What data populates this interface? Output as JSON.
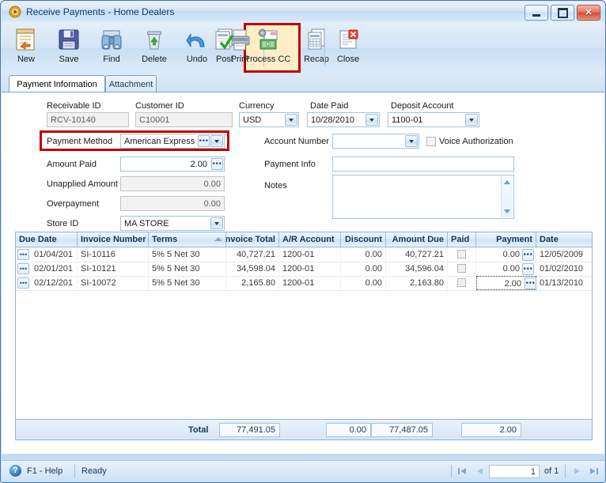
{
  "window": {
    "title": "Receive Payments - Home Dealers",
    "app_icon": "play-circle-icon",
    "controls": {
      "minimize": "Minimize",
      "maximize": "Maximize",
      "close": "Close"
    }
  },
  "toolbar": {
    "items": [
      {
        "label": "New",
        "icon": "new-document-icon"
      },
      {
        "label": "Save",
        "icon": "save-floppy-icon"
      },
      {
        "label": "Find",
        "icon": "binoculars-icon"
      },
      {
        "label": "Delete",
        "icon": "recycle-bin-icon"
      },
      {
        "label": "Undo",
        "icon": "undo-arrow-icon"
      },
      {
        "label": "Print",
        "icon": "printer-icon"
      },
      {
        "label": "Post",
        "icon": "post-checkmark-icon"
      },
      {
        "label": "Process CC",
        "icon": "process-credit-card-icon"
      },
      {
        "label": "Recap",
        "icon": "recap-documents-icon"
      },
      {
        "label": "Close",
        "icon": "close-document-icon"
      }
    ]
  },
  "tabs": [
    {
      "label": "Payment Information",
      "active": true
    },
    {
      "label": "Attachment",
      "active": false
    }
  ],
  "form": {
    "receivable_id": {
      "label": "Receivable ID",
      "value": "RCV-10140"
    },
    "customer_id": {
      "label": "Customer ID",
      "value": "C10001"
    },
    "currency": {
      "label": "Currency",
      "value": "USD"
    },
    "date_paid": {
      "label": "Date Paid",
      "value": "10/28/2010"
    },
    "deposit_account": {
      "label": "Deposit Account",
      "value": "1100-01"
    },
    "payment_method": {
      "label": "Payment Method",
      "value": "American Express"
    },
    "amount_paid": {
      "label": "Amount Paid",
      "value": "2.00"
    },
    "unapplied_amount": {
      "label": "Unapplied Amount",
      "value": "0.00"
    },
    "overpayment": {
      "label": "Overpayment",
      "value": "0.00"
    },
    "store_id": {
      "label": "Store ID",
      "value": "MA STORE"
    },
    "account_number": {
      "label": "Account Number",
      "value": ""
    },
    "voice_auth": {
      "label": "Voice Authorization",
      "checked": false
    },
    "payment_info": {
      "label": "Payment Info",
      "value": ""
    },
    "notes": {
      "label": "Notes",
      "value": ""
    }
  },
  "grid": {
    "columns": [
      {
        "key": "due_date",
        "label": "Due Date",
        "align": "left"
      },
      {
        "key": "invoice_number",
        "label": "Invoice Number",
        "align": "left"
      },
      {
        "key": "terms",
        "label": "Terms",
        "align": "left",
        "sorted": true
      },
      {
        "key": "invoice_total",
        "label": "nvoice Total",
        "align": "right"
      },
      {
        "key": "ar_account",
        "label": "A/R Account",
        "align": "left"
      },
      {
        "key": "discount",
        "label": "Discount",
        "align": "right"
      },
      {
        "key": "amount_due",
        "label": "Amount Due",
        "align": "right"
      },
      {
        "key": "paid",
        "label": "Paid",
        "align": "left"
      },
      {
        "key": "payment",
        "label": "Payment",
        "align": "right"
      },
      {
        "key": "date",
        "label": "Date",
        "align": "left"
      }
    ],
    "rows": [
      {
        "due_date": "01/04/201",
        "invoice_number": "SI-10116",
        "terms": "5% 5 Net 30",
        "invoice_total": "40,727.21",
        "ar_account": "1200-01",
        "discount": "0.00",
        "amount_due": "40,727.21",
        "paid": false,
        "payment": "0.00",
        "date": "12/05/2009"
      },
      {
        "due_date": "02/01/201",
        "invoice_number": "SI-10121",
        "terms": "5% 5 Net 30",
        "invoice_total": "34,598.04",
        "ar_account": "1200-01",
        "discount": "0.00",
        "amount_due": "34,596.04",
        "paid": false,
        "payment": "0.00",
        "date": "01/02/2010"
      },
      {
        "due_date": "02/12/201",
        "invoice_number": "SI-10072",
        "terms": "5% 5 Net 30",
        "invoice_total": "2,165.80",
        "ar_account": "1200-01",
        "discount": "0.00",
        "amount_due": "2,163.80",
        "paid": false,
        "payment": "2.00",
        "date": "01/13/2010"
      }
    ],
    "totals": {
      "label": "Total",
      "invoice_total": "77,491.05",
      "discount": "0.00",
      "amount_due": "77,487.05",
      "payment": "2.00"
    }
  },
  "statusbar": {
    "help": "F1 - Help",
    "state": "Ready",
    "nav": {
      "first": "first-record",
      "previous": "previous-record",
      "page": "1",
      "of_label": "of 1",
      "next": "next-record",
      "last": "last-record"
    }
  },
  "colors": {
    "highlight_border": "#c00000",
    "highlight_fill": "#fdeec8",
    "accent": "#14375d"
  }
}
